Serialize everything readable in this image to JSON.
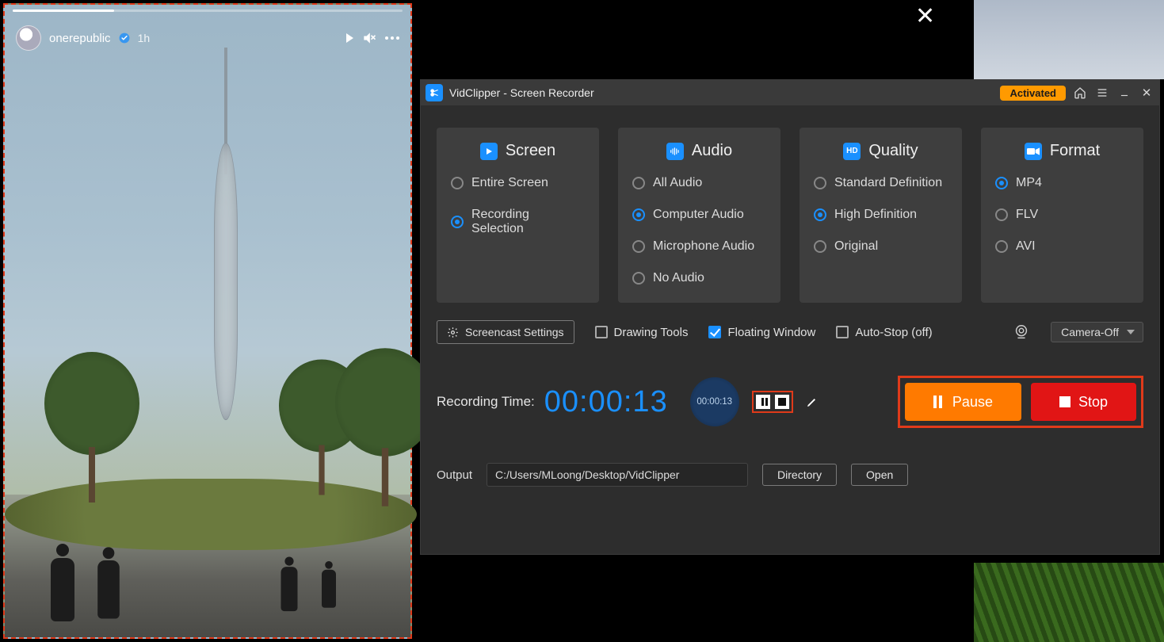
{
  "story": {
    "username": "onerepublic",
    "age": "1h"
  },
  "app": {
    "title": "VidClipper - Screen Recorder",
    "activated": "Activated"
  },
  "panels": {
    "screen": {
      "title": "Screen",
      "opts": [
        "Entire Screen",
        "Recording Selection"
      ],
      "sel": 1
    },
    "audio": {
      "title": "Audio",
      "opts": [
        "All Audio",
        "Computer Audio",
        "Microphone Audio",
        "No Audio"
      ],
      "sel": 1
    },
    "quality": {
      "title": "Quality",
      "opts": [
        "Standard Definition",
        "High Definition",
        "Original"
      ],
      "sel": 1
    },
    "format": {
      "title": "Format",
      "opts": [
        "MP4",
        "FLV",
        "AVI"
      ],
      "sel": 0
    }
  },
  "toolbar": {
    "screencast": "Screencast Settings",
    "drawing": "Drawing Tools",
    "floating": "Floating Window",
    "autostop": "Auto-Stop  (off)",
    "camera": "Camera-Off"
  },
  "rec": {
    "label": "Recording Time:",
    "time": "00:00:13",
    "bubble_time": "00:00:13",
    "pause": "Pause",
    "stop": "Stop"
  },
  "out": {
    "label": "Output",
    "path": "C:/Users/MLoong/Desktop/VidClipper",
    "dir": "Directory",
    "open": "Open"
  }
}
